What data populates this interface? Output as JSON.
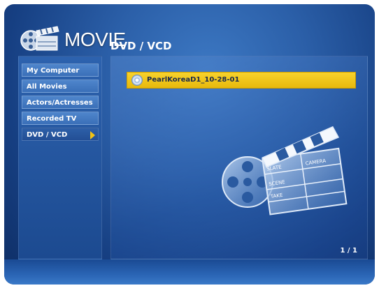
{
  "header": {
    "app_title": "MOVIE",
    "page_title": "DVD / VCD"
  },
  "sidebar": {
    "items": [
      {
        "label": "My Computer"
      },
      {
        "label": "All Movies"
      },
      {
        "label": "Actors/Actresses"
      },
      {
        "label": "Recorded TV"
      },
      {
        "label": "DVD / VCD"
      }
    ]
  },
  "content": {
    "files": [
      {
        "name": "PearlKoreaD1_10-28-01",
        "icon": "disc-icon"
      }
    ],
    "pager": "1 / 1",
    "clapper_labels": {
      "slate": "SLATE",
      "camera": "CAMERA",
      "scene": "SCENE",
      "take": "TAKE"
    }
  },
  "colors": {
    "selection": "#f2c314",
    "accent_arrow": "#f2c314"
  }
}
